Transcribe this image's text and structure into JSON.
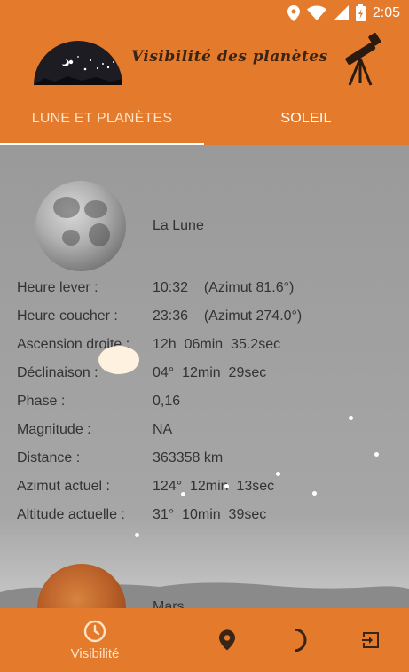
{
  "status_bar": {
    "time": "2:05",
    "icons": [
      "location-pin-icon",
      "wifi-icon",
      "signal-icon",
      "battery-charging-icon"
    ]
  },
  "header": {
    "title": "Visibilité des planètes",
    "logo_icon": "night-sky-logo-icon",
    "telescope_icon": "telescope-icon"
  },
  "tabs": [
    {
      "label": "LUNE ET PLANÈTES",
      "active": true
    },
    {
      "label": "SOLEIL",
      "active": false
    }
  ],
  "moon": {
    "name": "La Lune",
    "details": [
      {
        "label": "Heure lever :",
        "value": "10:32    (Azimut 81.6°)"
      },
      {
        "label": "Heure coucher :",
        "value": "23:36    (Azimut 274.0°)"
      },
      {
        "label": "Ascension droite :",
        "value": "12h  06min  35.2sec"
      },
      {
        "label": "Déclinaison :",
        "value": "04°  12min  29sec"
      },
      {
        "label": "Phase :",
        "value": "0,16"
      },
      {
        "label": "Magnitude :",
        "value": "NA"
      },
      {
        "label": "Distance :",
        "value": "363358 km"
      },
      {
        "label": "Azimut actuel :",
        "value": "124°  12min  13sec"
      },
      {
        "label": "Altitude actuelle :",
        "value": "31°  10min  39sec"
      }
    ]
  },
  "next_planet": {
    "name": "Mars"
  },
  "bottom_nav": [
    {
      "label": "Visibilité",
      "icon": "clock-icon",
      "active": true
    },
    {
      "label": "",
      "icon": "location-pin-icon",
      "active": false
    },
    {
      "label": "",
      "icon": "moon-crescent-icon",
      "active": false
    },
    {
      "label": "",
      "icon": "exit-icon",
      "active": false
    }
  ],
  "colors": {
    "primary": "#e47a2c",
    "tab_active_text": "#fde3c8",
    "content_bg": "#9d9d9d",
    "text": "#333333"
  }
}
